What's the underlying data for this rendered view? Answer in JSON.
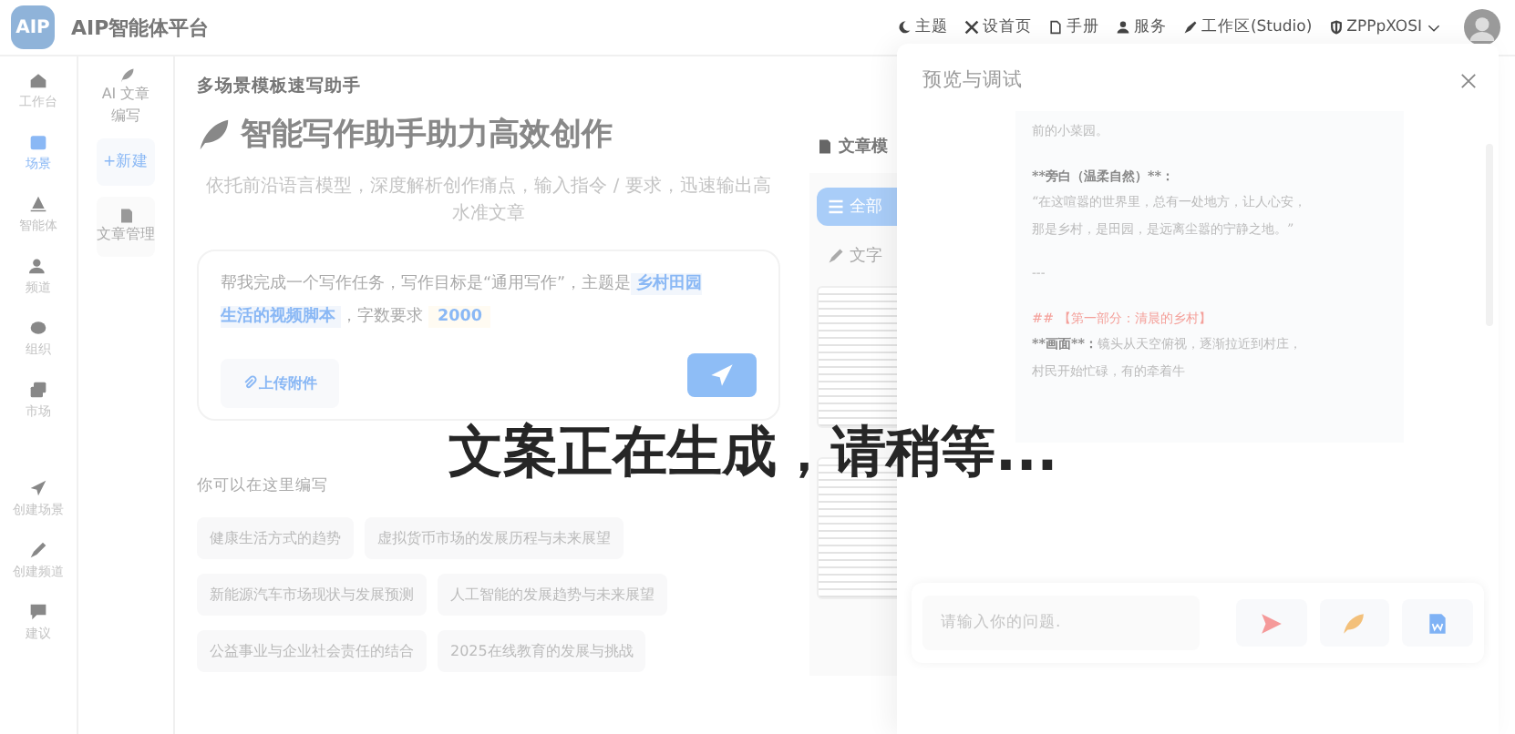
{
  "header": {
    "logo": "AIP",
    "title": "AIP智能体平台",
    "nav": [
      {
        "label": "主题"
      },
      {
        "label": "设首页"
      },
      {
        "label": "手册"
      },
      {
        "label": "服务"
      },
      {
        "label": "工作区(Studio)"
      },
      {
        "label": "ZPPpXOSI"
      }
    ]
  },
  "left_nav": [
    {
      "label": "工作台",
      "selected": false
    },
    {
      "label": "场景",
      "selected": true
    },
    {
      "label": "智能体",
      "selected": false
    },
    {
      "label": "频道",
      "selected": false
    },
    {
      "label": "组织",
      "selected": false
    },
    {
      "label": "市场",
      "selected": false
    },
    {
      "label": "创建场景",
      "selected": false
    },
    {
      "label": "创建频道",
      "selected": false
    },
    {
      "label": "建议",
      "selected": false
    }
  ],
  "sub_nav": {
    "title": "AI 文章编写",
    "new_button": "+新建",
    "items": [
      {
        "label": "文章管理"
      }
    ]
  },
  "main": {
    "heading": "多场景模板速写助手",
    "title": "智能写作助手助力高效创作",
    "subtitle": "依托前沿语言模型，深度解析创作痛点，输入指令 / 要求，迅速输出高水准文章",
    "prompt": [
      {
        "kind": "text",
        "text": "帮我完成一个写作任务，写作目标是“通用写作”，主题是"
      },
      {
        "kind": "topic",
        "text": "乡村田园生活的视频脚本"
      },
      {
        "kind": "text",
        "text": "，字数要求"
      },
      {
        "kind": "count",
        "text": "2000"
      }
    ],
    "upload": "上传附件",
    "suggestions_label": "你可以在这里编写",
    "suggestions": [
      "健康生活方式的趋势",
      "虚拟货币市场的发展历程与未来展望",
      "新能源汽车市场现状与发展预测",
      "人工智能的发展趋势与未来展望",
      "公益事业与企业社会责任的结合",
      "2025在线教育的发展与挑战"
    ]
  },
  "templates": {
    "title": "文章模",
    "filters": [
      {
        "label": "全部",
        "selected": true
      },
      {
        "label": "文字",
        "selected": false
      }
    ]
  },
  "drawer": {
    "title": "预览与调试",
    "preview": [
      {
        "kind": "text",
        "text": "前的小菜园。"
      },
      {
        "kind": "blank"
      },
      {
        "kind": "strong",
        "lead": "**旁白（温柔自然）**："
      },
      {
        "kind": "text",
        "text": "“在这喧嚣的世界里，总有一处地方，让人心安，"
      },
      {
        "kind": "text",
        "text": "那是乡村，是田园，是远离尘嚣的宁静之地。”"
      },
      {
        "kind": "blank"
      },
      {
        "kind": "rule",
        "text": "---"
      },
      {
        "kind": "blank"
      },
      {
        "kind": "heading",
        "text": "## 【第一部分：清晨的乡村】"
      },
      {
        "kind": "strong",
        "lead": "**画面**：",
        "text": "镜头从天空俯视，逐渐拉近到村庄，"
      },
      {
        "kind": "text",
        "text": "村民开始忙碌，有的牵着牛"
      }
    ],
    "placeholder": "请输入你的问题."
  },
  "loading": "文案正在生成，请稍等..."
}
